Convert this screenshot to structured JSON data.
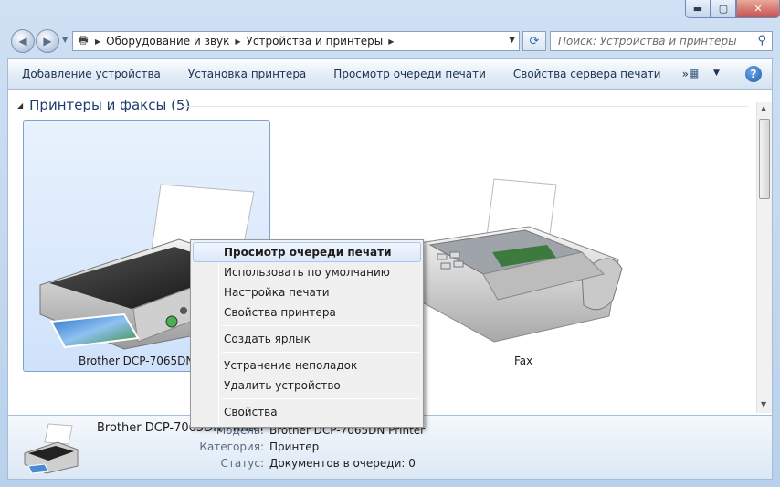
{
  "window": {
    "minimize": "▬",
    "maximize": "▢",
    "close": "✕"
  },
  "address": {
    "crumbs": [
      "Оборудование и звук",
      "Устройства и принтеры"
    ],
    "search_placeholder": "Поиск: Устройства и принтеры"
  },
  "toolbar": {
    "items": [
      "Добавление устройства",
      "Установка принтера",
      "Просмотр очереди печати",
      "Свойства сервера печати"
    ],
    "more": "»"
  },
  "group": {
    "title": "Принтеры и факсы (5)"
  },
  "devices": [
    {
      "label": "Brother DCP-7065DN Pri",
      "selected": true
    },
    {
      "label": "Fax",
      "selected": false
    }
  ],
  "context_menu": {
    "items": [
      {
        "label": "Просмотр очереди печати",
        "default": true
      },
      {
        "label": "Использовать по умолчанию"
      },
      {
        "label": "Настройка печати"
      },
      {
        "label": "Свойства принтера"
      },
      {
        "label": "Создать ярлык"
      },
      {
        "label": "Устранение неполадок"
      },
      {
        "label": "Удалить устройство"
      },
      {
        "label": "Свойства"
      }
    ]
  },
  "details": {
    "name": "Brother DCP-7065DN Printer",
    "rows": [
      {
        "label": "Модель:",
        "value": "Brother DCP-7065DN Printer"
      },
      {
        "label": "Категория:",
        "value": "Принтер"
      },
      {
        "label": "Статус:",
        "value": "Документов в очереди: 0"
      }
    ]
  },
  "colors": {
    "selection": "#cfe2fb",
    "window_frame": "#b9d1ec"
  }
}
